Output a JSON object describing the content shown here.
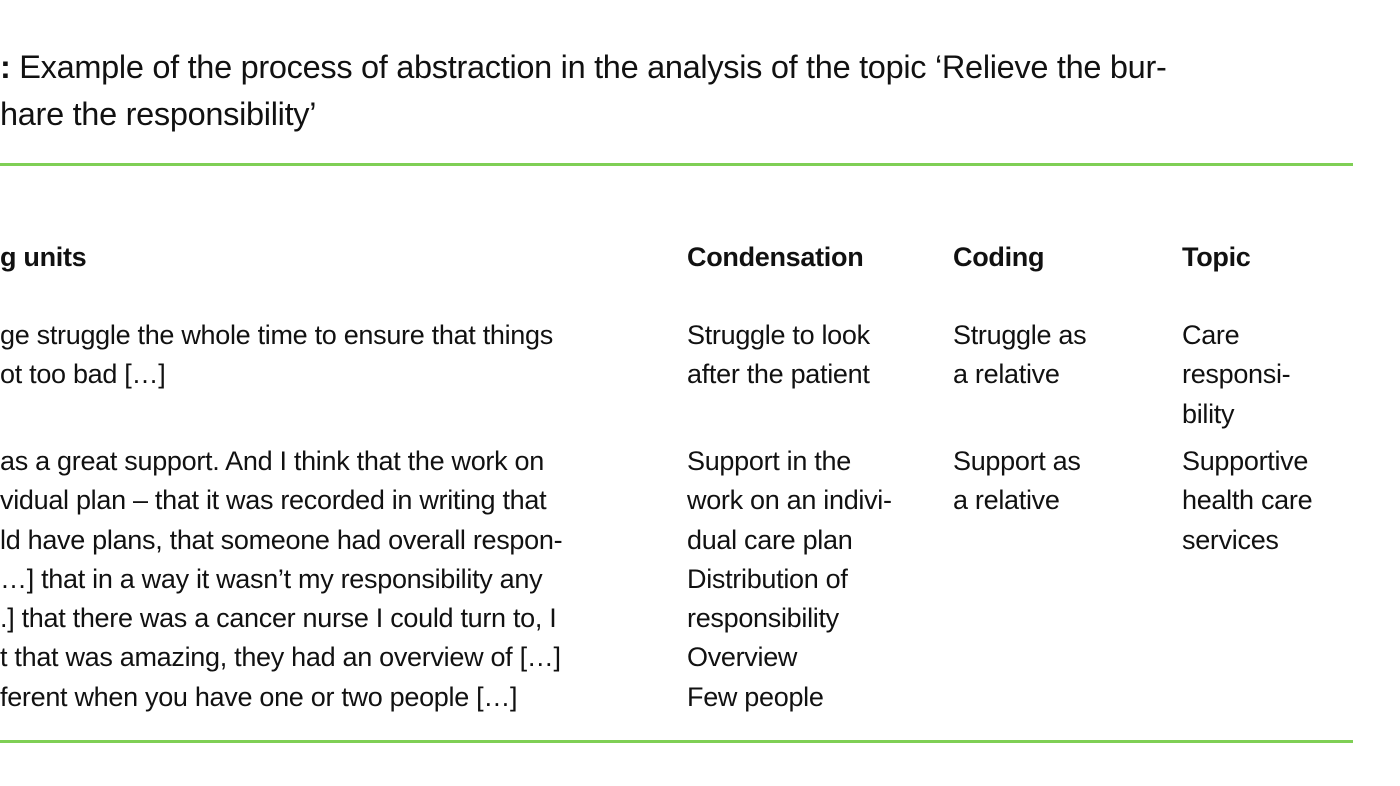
{
  "caption": {
    "label_suffix": ":",
    "text_line1": " Example of the process of abstraction in the analysis of the topic ‘Relieve the bur-",
    "text_line2": "hare the responsibility’"
  },
  "table": {
    "headers": [
      "g units",
      "Condensation",
      "Coding",
      "Topic"
    ],
    "rows": [
      {
        "meaning_unit": [
          "ge struggle the whole time to ensure that things",
          "ot too bad […]"
        ],
        "condensation": [
          "Struggle to look",
          "after the patient"
        ],
        "coding": [
          "Struggle as",
          "a relative"
        ],
        "topic": [
          "Care",
          "responsi-",
          "bility"
        ]
      },
      {
        "meaning_unit": [
          "as a great support. And I think that the work on",
          "vidual plan – that it was recorded in writing that",
          "ld have plans, that someone had overall respon-",
          "…] that in a way it wasn’t my responsibility any",
          ".] that there was a cancer nurse I could turn to, I",
          "t that was amazing, they had an overview of […]",
          "ferent when you have one or two people […]"
        ],
        "condensation": [
          "Support in the",
          "work on an indivi-",
          "dual care plan",
          "Distribution of",
          "responsibility",
          "Overview",
          "Few people"
        ],
        "coding": [
          "Support as",
          "a relative"
        ],
        "topic": [
          "Supportive",
          "health care",
          "services"
        ]
      }
    ]
  },
  "colors": {
    "rule": "#7fcf55",
    "text": "#111111"
  }
}
